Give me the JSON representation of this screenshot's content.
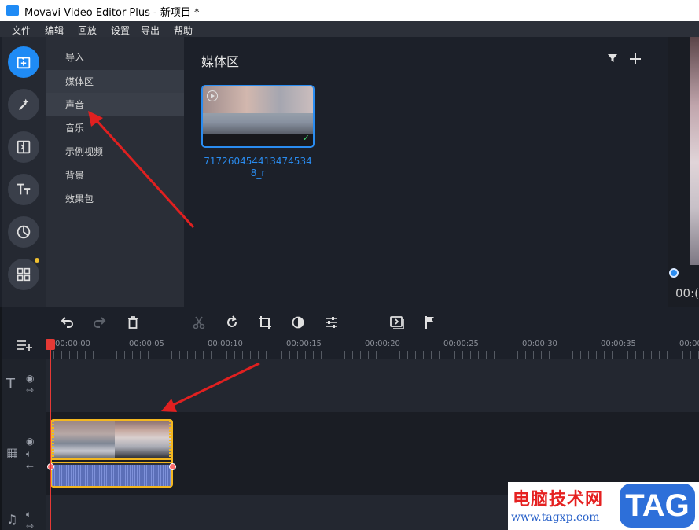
{
  "window": {
    "title": "Movavi Video Editor Plus - 新项目 *"
  },
  "menubar": [
    "文件",
    "编辑",
    "回放",
    "设置",
    "导出",
    "帮助"
  ],
  "categories": [
    {
      "label": "导入"
    },
    {
      "label": "媒体区"
    },
    {
      "label": "声音"
    },
    {
      "label": "音乐"
    },
    {
      "label": "示例视频"
    },
    {
      "label": "背景"
    },
    {
      "label": "效果包"
    }
  ],
  "media": {
    "title": "媒体区",
    "items": [
      {
        "label": "7172604544134745348_r"
      }
    ]
  },
  "preview": {
    "timecode": "00:("
  },
  "ruler": [
    "00:00:00",
    "00:00:05",
    "00:00:10",
    "00:00:15",
    "00:00:20",
    "00:00:25",
    "00:00:30",
    "00:00:35",
    "00:00:"
  ],
  "watermark": {
    "site_cn": "电脑技术网",
    "url": "www.tagxp.com",
    "tag": "TAG"
  },
  "colors": {
    "accent": "#1f8bf5",
    "clip_border": "#f3b720",
    "playhead": "#e53935",
    "annotation": "#e02020"
  }
}
